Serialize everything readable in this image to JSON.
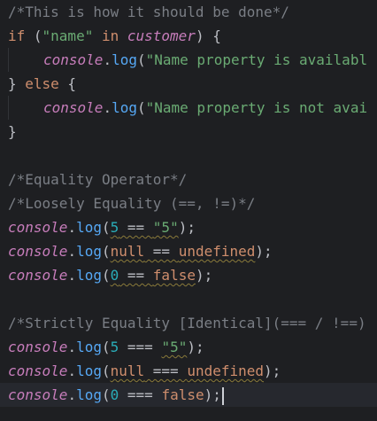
{
  "code": {
    "lines": [
      {
        "tokens": [
          {
            "t": "comment",
            "v": "/*This is how it should be done*/"
          }
        ]
      },
      {
        "tokens": [
          {
            "t": "keyword",
            "v": "if"
          },
          {
            "t": "punc",
            "v": " ("
          },
          {
            "t": "string",
            "v": "\"name\""
          },
          {
            "t": "punc",
            "v": " "
          },
          {
            "t": "keyword",
            "v": "in"
          },
          {
            "t": "punc",
            "v": " "
          },
          {
            "t": "global",
            "v": "customer"
          },
          {
            "t": "punc",
            "v": ") {"
          }
        ]
      },
      {
        "indent": 1,
        "tokens": [
          {
            "t": "global",
            "v": "console"
          },
          {
            "t": "punc",
            "v": "."
          },
          {
            "t": "method",
            "v": "log"
          },
          {
            "t": "punc",
            "v": "("
          },
          {
            "t": "string",
            "v": "\"Name property is availabl"
          }
        ]
      },
      {
        "tokens": [
          {
            "t": "punc",
            "v": "} "
          },
          {
            "t": "keyword",
            "v": "else"
          },
          {
            "t": "punc",
            "v": " {"
          }
        ]
      },
      {
        "indent": 1,
        "tokens": [
          {
            "t": "global",
            "v": "console"
          },
          {
            "t": "punc",
            "v": "."
          },
          {
            "t": "method",
            "v": "log"
          },
          {
            "t": "punc",
            "v": "("
          },
          {
            "t": "string",
            "v": "\"Name property is not avai"
          }
        ]
      },
      {
        "tokens": [
          {
            "t": "punc",
            "v": "}"
          }
        ]
      },
      {
        "tokens": []
      },
      {
        "tokens": [
          {
            "t": "comment",
            "v": "/*Equality Operator*/"
          }
        ]
      },
      {
        "tokens": [
          {
            "t": "comment",
            "v": "/*Loosely Equality (==, !=)*/"
          }
        ]
      },
      {
        "tokens": [
          {
            "t": "global",
            "v": "console"
          },
          {
            "t": "punc",
            "v": "."
          },
          {
            "t": "method",
            "v": "log"
          },
          {
            "t": "punc",
            "v": "("
          },
          {
            "t": "num",
            "v": "5",
            "warn": true
          },
          {
            "t": "punc",
            "v": " == ",
            "warn": true
          },
          {
            "t": "string",
            "v": "\"5\"",
            "warn": true
          },
          {
            "t": "punc",
            "v": ");"
          }
        ]
      },
      {
        "tokens": [
          {
            "t": "global",
            "v": "console"
          },
          {
            "t": "punc",
            "v": "."
          },
          {
            "t": "method",
            "v": "log"
          },
          {
            "t": "punc",
            "v": "("
          },
          {
            "t": "keyword",
            "v": "null",
            "warn": true
          },
          {
            "t": "punc",
            "v": " == ",
            "warn": true
          },
          {
            "t": "keyword",
            "v": "undefined",
            "warn": true
          },
          {
            "t": "punc",
            "v": ");"
          }
        ]
      },
      {
        "tokens": [
          {
            "t": "global",
            "v": "console"
          },
          {
            "t": "punc",
            "v": "."
          },
          {
            "t": "method",
            "v": "log"
          },
          {
            "t": "punc",
            "v": "("
          },
          {
            "t": "num",
            "v": "0",
            "warn": true
          },
          {
            "t": "punc",
            "v": " == ",
            "warn": true
          },
          {
            "t": "keyword",
            "v": "false",
            "warn": true
          },
          {
            "t": "punc",
            "v": ");"
          }
        ]
      },
      {
        "tokens": []
      },
      {
        "tokens": [
          {
            "t": "comment",
            "v": "/*Strictly Equality [Identical](=== / !==)"
          }
        ]
      },
      {
        "tokens": [
          {
            "t": "global",
            "v": "console"
          },
          {
            "t": "punc",
            "v": "."
          },
          {
            "t": "method",
            "v": "log"
          },
          {
            "t": "punc",
            "v": "("
          },
          {
            "t": "num",
            "v": "5"
          },
          {
            "t": "punc",
            "v": " === "
          },
          {
            "t": "string",
            "v": "\"5\"",
            "warn": true
          },
          {
            "t": "punc",
            "v": ");"
          }
        ]
      },
      {
        "tokens": [
          {
            "t": "global",
            "v": "console"
          },
          {
            "t": "punc",
            "v": "."
          },
          {
            "t": "method",
            "v": "log"
          },
          {
            "t": "punc",
            "v": "("
          },
          {
            "t": "keyword",
            "v": "null",
            "warn": true
          },
          {
            "t": "punc",
            "v": " === ",
            "warn": true
          },
          {
            "t": "keyword",
            "v": "undefined",
            "warn": true
          },
          {
            "t": "punc",
            "v": ");"
          }
        ]
      },
      {
        "current": true,
        "caret": true,
        "tokens": [
          {
            "t": "global",
            "v": "console"
          },
          {
            "t": "punc",
            "v": "."
          },
          {
            "t": "method",
            "v": "log"
          },
          {
            "t": "punc",
            "v": "("
          },
          {
            "t": "num",
            "v": "0"
          },
          {
            "t": "punc",
            "v": " === "
          },
          {
            "t": "keyword",
            "v": "false"
          },
          {
            "t": "punc",
            "v": ");"
          }
        ]
      }
    ]
  },
  "colors": {
    "background": "#1e1f22",
    "current_line": "#26282e",
    "comment": "#7a7e85",
    "keyword": "#cf8e6d",
    "string": "#6aab73",
    "global": "#c77dbb",
    "method": "#56a8f5",
    "number": "#2aacb8",
    "text": "#bcbec4"
  }
}
